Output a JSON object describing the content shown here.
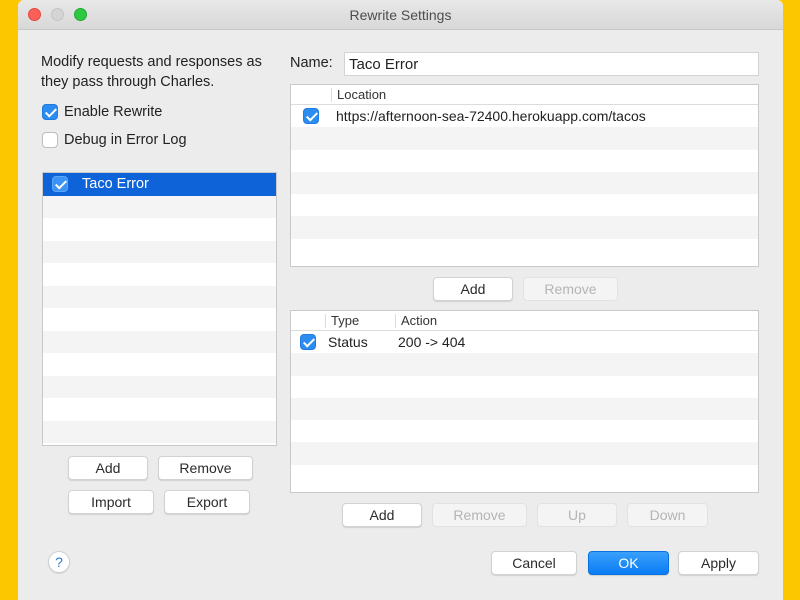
{
  "window": {
    "title": "Rewrite Settings"
  },
  "left": {
    "description": "Modify requests and responses as they pass through Charles.",
    "enable_rewrite": {
      "label": "Enable Rewrite",
      "checked": true
    },
    "debug_error_log": {
      "label": "Debug in Error Log",
      "checked": false
    },
    "sets": [
      {
        "name": "Taco Error",
        "enabled": true,
        "selected": true
      }
    ],
    "buttons": {
      "add": "Add",
      "remove": "Remove",
      "import": "Import",
      "export": "Export"
    }
  },
  "name_field": {
    "label": "Name:",
    "value": "Taco Error"
  },
  "locations": {
    "columns": [
      "",
      "Location"
    ],
    "rows": [
      {
        "enabled": true,
        "location": "https://afternoon-sea-72400.herokuapp.com/tacos"
      }
    ],
    "buttons": {
      "add": "Add",
      "remove": "Remove"
    }
  },
  "rules": {
    "columns": [
      "",
      "Type",
      "Action"
    ],
    "rows": [
      {
        "enabled": true,
        "type": "Status",
        "action": "200 -> 404"
      }
    ],
    "buttons": {
      "add": "Add",
      "remove": "Remove",
      "up": "Up",
      "down": "Down"
    }
  },
  "footer": {
    "help": "?",
    "cancel": "Cancel",
    "ok": "OK",
    "apply": "Apply"
  },
  "colors": {
    "background": "#fdc700",
    "accent": "#0a7cf5",
    "selection": "#0f63d8"
  }
}
